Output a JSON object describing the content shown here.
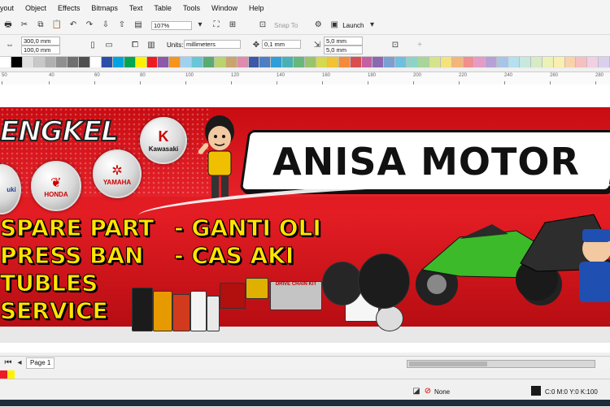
{
  "menu": [
    "yout",
    "Object",
    "Effects",
    "Bitmaps",
    "Text",
    "Table",
    "Tools",
    "Window",
    "Help"
  ],
  "toolbar": {
    "zoom_value": "107%",
    "snap_label": "Snap To",
    "launch_label": "Launch"
  },
  "property_bar": {
    "width": "300,0 mm",
    "height": "100,0 mm",
    "units_label": "Units:",
    "units_value": "millimeters",
    "nudge": "0,1 mm",
    "dup_x": "5,0 mm",
    "dup_y": "5,0 mm"
  },
  "palette_colors": [
    "#ffffff",
    "#000000",
    "#e0e0e0",
    "#c8c8c8",
    "#b0b0b0",
    "#909090",
    "#707070",
    "#505050",
    "#ffffff",
    "#2b4fa8",
    "#00a3e0",
    "#00a651",
    "#fff200",
    "#ed1c24",
    "#8b5aa8",
    "#f7941d",
    "#a0d2f0",
    "#69c6d6",
    "#5aab72",
    "#b9d36d",
    "#c9a46e",
    "#e08ab0",
    "#3c58a8",
    "#4d7ec2",
    "#2f9fd9",
    "#49b1b5",
    "#67b77c",
    "#9ac46c",
    "#d6d84d",
    "#f1c232",
    "#f58a3c",
    "#d94f4f",
    "#c45fa1",
    "#8c68b0",
    "#7c9fd2",
    "#6ec0e0",
    "#8ed3c7",
    "#a8d69a",
    "#d5e48a",
    "#f4e27a",
    "#f5b57a",
    "#ef8f8f",
    "#e59bc6",
    "#b7a0d6",
    "#a8c4e6",
    "#b4e0ef",
    "#c7e8de",
    "#d6ecc4",
    "#ecf2b6",
    "#fbefaf",
    "#f9d2ac",
    "#f6c0c0",
    "#f2cfe3",
    "#dad0ee"
  ],
  "ruler_ticks": [
    "50",
    "40",
    "60",
    "80",
    "100",
    "120",
    "140",
    "160",
    "180",
    "200",
    "220",
    "240",
    "260",
    "280"
  ],
  "banner": {
    "brand": "ENGKEL",
    "title": "ANISA MOTOR",
    "logos": [
      "Kawasaki",
      "YAMAHA",
      "HONDA",
      "uki"
    ],
    "services_left": [
      "SPARE PART",
      "PRESS BAN",
      "TUBLES",
      "SERVICE"
    ],
    "services_right": [
      "- GANTI OLI",
      "- CAS AKI"
    ],
    "product_labels": [
      "DRIVE CHAIN KIT",
      "AIR FILTER"
    ]
  },
  "page_tab": "Page 1",
  "status": {
    "fill": "None",
    "color_readout": "C:0 M:0 Y:0 K:100"
  }
}
